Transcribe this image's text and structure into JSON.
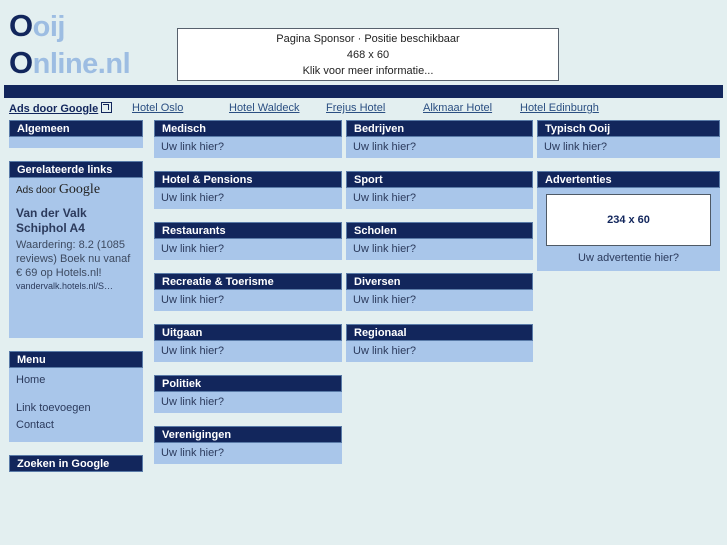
{
  "site": {
    "logo_line1_cap": "O",
    "logo_line1_rest": "oij",
    "logo_line2_cap": "O",
    "logo_line2_rest": "nline.nl"
  },
  "sponsor": {
    "line1": "Pagina Sponsor · Positie beschikbaar",
    "line2": "468 x 60",
    "line3": "Klik voor meer informatie..."
  },
  "adsbar": {
    "label": "Ads door Google",
    "links": [
      "Hotel Oslo",
      "Hotel Waldeck",
      "Frejus Hotel",
      "Alkmaar Hotel",
      "Hotel Edinburgh"
    ]
  },
  "sidebar": {
    "algemeen": {
      "title": "Algemeen"
    },
    "related": {
      "title": "Gerelateerde links",
      "ads_prefix": "Ads door ",
      "ads_brand": "Google",
      "ad_title_line1": "Van der Valk",
      "ad_title_line2": "Schiphol A4",
      "ad_desc": "Waardering: 8.2 (1085 reviews) Boek nu vanaf € 69 op Hotels.nl!",
      "ad_url": "vandervalk.hotels.nl/S…"
    },
    "menu": {
      "title": "Menu",
      "items": [
        "Home",
        "Link toevoegen",
        "Contact"
      ]
    },
    "search": {
      "title": "Zoeken in Google"
    }
  },
  "columns": {
    "col1": [
      {
        "title": "Medisch",
        "link": "Uw link hier?"
      },
      {
        "title": "Hotel & Pensions",
        "link": "Uw link hier?"
      },
      {
        "title": "Restaurants",
        "link": "Uw link hier?"
      },
      {
        "title": "Recreatie & Toerisme",
        "link": "Uw link hier?"
      },
      {
        "title": "Uitgaan",
        "link": "Uw link hier?"
      },
      {
        "title": "Politiek",
        "link": "Uw link hier?"
      },
      {
        "title": "Verenigingen",
        "link": "Uw link hier?"
      }
    ],
    "col2": [
      {
        "title": "Bedrijven",
        "link": "Uw link hier?"
      },
      {
        "title": "Sport",
        "link": "Uw link hier?"
      },
      {
        "title": "Scholen",
        "link": "Uw link hier?"
      },
      {
        "title": "Diversen",
        "link": "Uw link hier?"
      },
      {
        "title": "Regionaal",
        "link": "Uw link hier?"
      }
    ],
    "col3": {
      "typisch": {
        "title": "Typisch Ooij",
        "link": "Uw link hier?"
      },
      "advertenties": {
        "title": "Advertenties",
        "banner_label": "234 x 60",
        "caption": "Uw advertentie hier?"
      }
    }
  },
  "colors": {
    "navy": "#12265c",
    "light_blue": "#a9c6ea",
    "page_bg": "#e3eff0",
    "logo_light": "#9dbde2",
    "link_blue": "#2b4f82"
  }
}
